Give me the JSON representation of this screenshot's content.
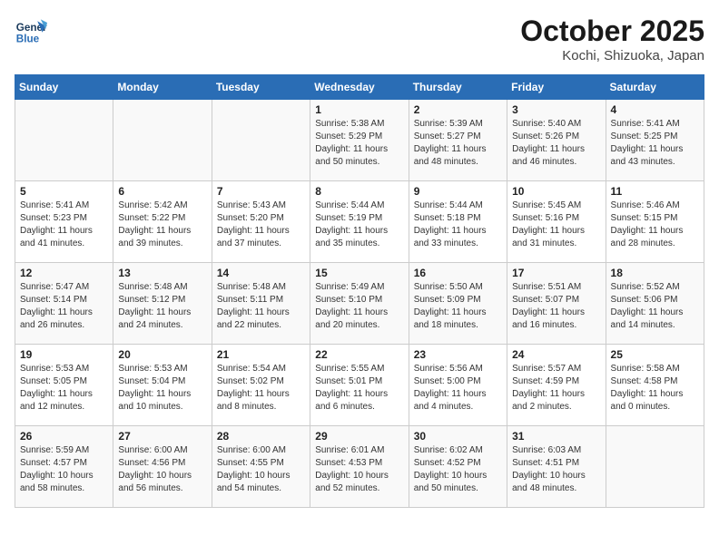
{
  "header": {
    "logo_general": "General",
    "logo_blue": "Blue",
    "title": "October 2025",
    "subtitle": "Kochi, Shizuoka, Japan"
  },
  "weekdays": [
    "Sunday",
    "Monday",
    "Tuesday",
    "Wednesday",
    "Thursday",
    "Friday",
    "Saturday"
  ],
  "weeks": [
    [
      {
        "day": "",
        "info": ""
      },
      {
        "day": "",
        "info": ""
      },
      {
        "day": "",
        "info": ""
      },
      {
        "day": "1",
        "info": "Sunrise: 5:38 AM\nSunset: 5:29 PM\nDaylight: 11 hours\nand 50 minutes."
      },
      {
        "day": "2",
        "info": "Sunrise: 5:39 AM\nSunset: 5:27 PM\nDaylight: 11 hours\nand 48 minutes."
      },
      {
        "day": "3",
        "info": "Sunrise: 5:40 AM\nSunset: 5:26 PM\nDaylight: 11 hours\nand 46 minutes."
      },
      {
        "day": "4",
        "info": "Sunrise: 5:41 AM\nSunset: 5:25 PM\nDaylight: 11 hours\nand 43 minutes."
      }
    ],
    [
      {
        "day": "5",
        "info": "Sunrise: 5:41 AM\nSunset: 5:23 PM\nDaylight: 11 hours\nand 41 minutes."
      },
      {
        "day": "6",
        "info": "Sunrise: 5:42 AM\nSunset: 5:22 PM\nDaylight: 11 hours\nand 39 minutes."
      },
      {
        "day": "7",
        "info": "Sunrise: 5:43 AM\nSunset: 5:20 PM\nDaylight: 11 hours\nand 37 minutes."
      },
      {
        "day": "8",
        "info": "Sunrise: 5:44 AM\nSunset: 5:19 PM\nDaylight: 11 hours\nand 35 minutes."
      },
      {
        "day": "9",
        "info": "Sunrise: 5:44 AM\nSunset: 5:18 PM\nDaylight: 11 hours\nand 33 minutes."
      },
      {
        "day": "10",
        "info": "Sunrise: 5:45 AM\nSunset: 5:16 PM\nDaylight: 11 hours\nand 31 minutes."
      },
      {
        "day": "11",
        "info": "Sunrise: 5:46 AM\nSunset: 5:15 PM\nDaylight: 11 hours\nand 28 minutes."
      }
    ],
    [
      {
        "day": "12",
        "info": "Sunrise: 5:47 AM\nSunset: 5:14 PM\nDaylight: 11 hours\nand 26 minutes."
      },
      {
        "day": "13",
        "info": "Sunrise: 5:48 AM\nSunset: 5:12 PM\nDaylight: 11 hours\nand 24 minutes."
      },
      {
        "day": "14",
        "info": "Sunrise: 5:48 AM\nSunset: 5:11 PM\nDaylight: 11 hours\nand 22 minutes."
      },
      {
        "day": "15",
        "info": "Sunrise: 5:49 AM\nSunset: 5:10 PM\nDaylight: 11 hours\nand 20 minutes."
      },
      {
        "day": "16",
        "info": "Sunrise: 5:50 AM\nSunset: 5:09 PM\nDaylight: 11 hours\nand 18 minutes."
      },
      {
        "day": "17",
        "info": "Sunrise: 5:51 AM\nSunset: 5:07 PM\nDaylight: 11 hours\nand 16 minutes."
      },
      {
        "day": "18",
        "info": "Sunrise: 5:52 AM\nSunset: 5:06 PM\nDaylight: 11 hours\nand 14 minutes."
      }
    ],
    [
      {
        "day": "19",
        "info": "Sunrise: 5:53 AM\nSunset: 5:05 PM\nDaylight: 11 hours\nand 12 minutes."
      },
      {
        "day": "20",
        "info": "Sunrise: 5:53 AM\nSunset: 5:04 PM\nDaylight: 11 hours\nand 10 minutes."
      },
      {
        "day": "21",
        "info": "Sunrise: 5:54 AM\nSunset: 5:02 PM\nDaylight: 11 hours\nand 8 minutes."
      },
      {
        "day": "22",
        "info": "Sunrise: 5:55 AM\nSunset: 5:01 PM\nDaylight: 11 hours\nand 6 minutes."
      },
      {
        "day": "23",
        "info": "Sunrise: 5:56 AM\nSunset: 5:00 PM\nDaylight: 11 hours\nand 4 minutes."
      },
      {
        "day": "24",
        "info": "Sunrise: 5:57 AM\nSunset: 4:59 PM\nDaylight: 11 hours\nand 2 minutes."
      },
      {
        "day": "25",
        "info": "Sunrise: 5:58 AM\nSunset: 4:58 PM\nDaylight: 11 hours\nand 0 minutes."
      }
    ],
    [
      {
        "day": "26",
        "info": "Sunrise: 5:59 AM\nSunset: 4:57 PM\nDaylight: 10 hours\nand 58 minutes."
      },
      {
        "day": "27",
        "info": "Sunrise: 6:00 AM\nSunset: 4:56 PM\nDaylight: 10 hours\nand 56 minutes."
      },
      {
        "day": "28",
        "info": "Sunrise: 6:00 AM\nSunset: 4:55 PM\nDaylight: 10 hours\nand 54 minutes."
      },
      {
        "day": "29",
        "info": "Sunrise: 6:01 AM\nSunset: 4:53 PM\nDaylight: 10 hours\nand 52 minutes."
      },
      {
        "day": "30",
        "info": "Sunrise: 6:02 AM\nSunset: 4:52 PM\nDaylight: 10 hours\nand 50 minutes."
      },
      {
        "day": "31",
        "info": "Sunrise: 6:03 AM\nSunset: 4:51 PM\nDaylight: 10 hours\nand 48 minutes."
      },
      {
        "day": "",
        "info": ""
      }
    ]
  ]
}
